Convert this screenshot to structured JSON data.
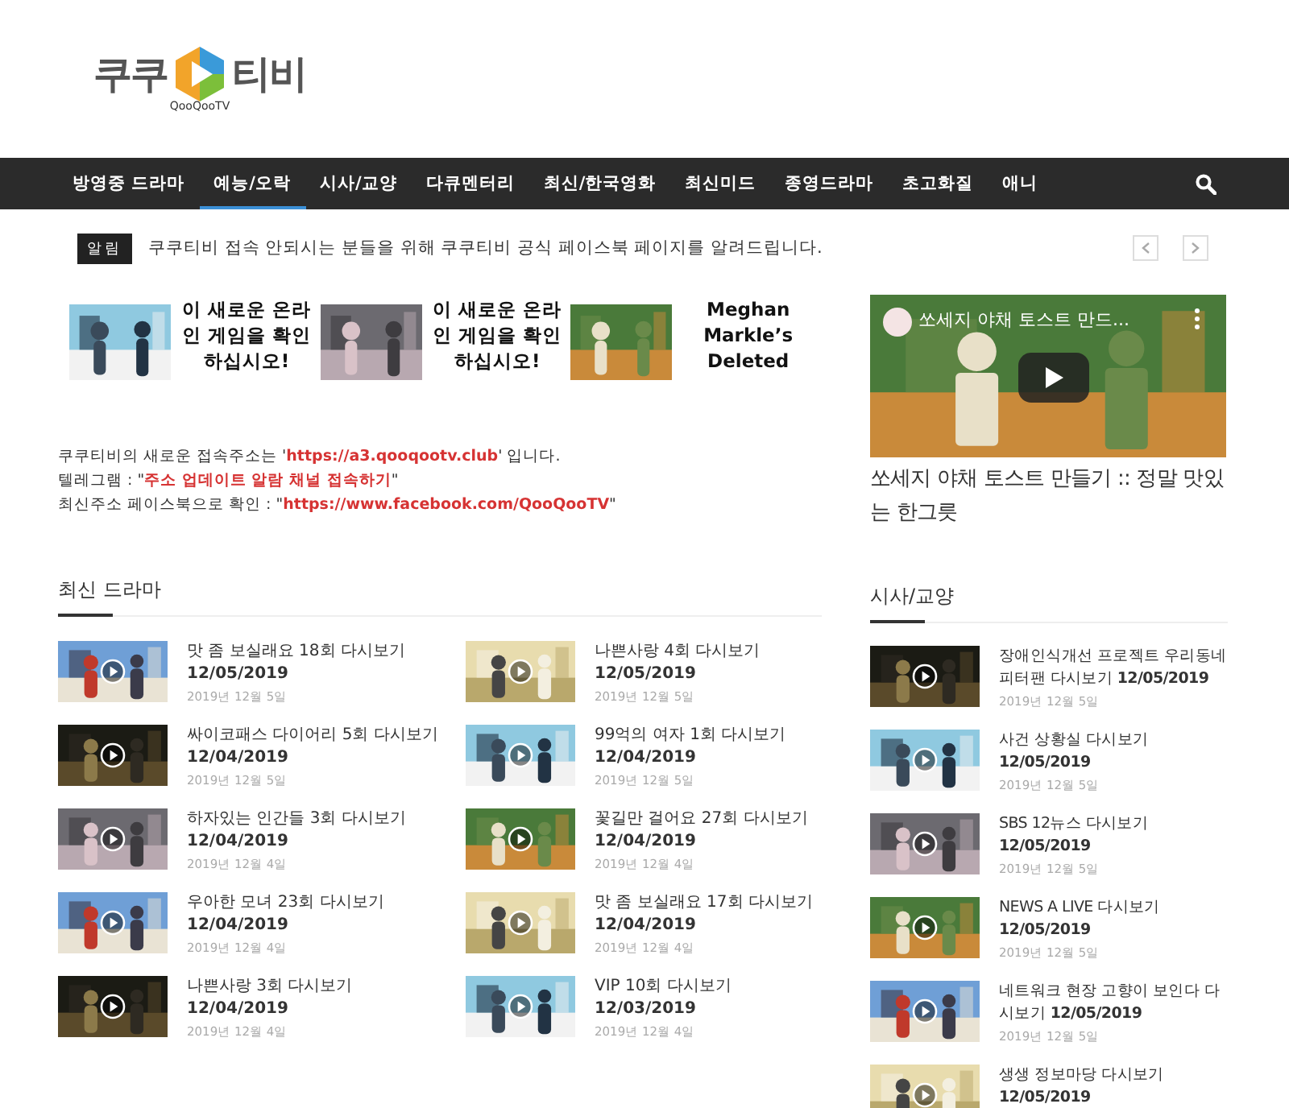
{
  "logo": {
    "left": "쿠쿠",
    "right": "티비",
    "subtitle": "QooQooTV"
  },
  "nav": {
    "items": [
      {
        "label": "방영중 드라마",
        "selected": false
      },
      {
        "label": "예능/오락",
        "selected": true
      },
      {
        "label": "시사/교양",
        "selected": false
      },
      {
        "label": "다큐멘터리",
        "selected": false
      },
      {
        "label": "최신/한국영화",
        "selected": false
      },
      {
        "label": "최신미드",
        "selected": false
      },
      {
        "label": "종영드라마",
        "selected": false
      },
      {
        "label": "초고화질",
        "selected": false
      },
      {
        "label": "애니",
        "selected": false
      }
    ]
  },
  "notice": {
    "badge": "알림",
    "text": "쿠쿠티비 접속 안되시는 분들을 위해 쿠쿠티비 공식 페이스북 페이지를 알려드립니다."
  },
  "ads": [
    {
      "text": "이 새로운 온라인 게임을 확인하십시오!"
    },
    {
      "text": "이 새로운 온라인 게임을 확인하십시오!"
    },
    {
      "text": "Meghan Markle’s Deleted"
    }
  ],
  "info_lines": [
    "쿠쿠티비의 새로운 접속주소는 '**https://a3.qooqootv.club**' 입니다.",
    "텔레그램 : \"**주소 업데이트 알람 채널 접속하기**\"",
    "최신주소 페이스북으로 확인 : \"**https://www.facebook.com/QooQooTV**\""
  ],
  "latest_drama": {
    "heading": "최신 드라마",
    "items": [
      {
        "title": "맛 좀 보실래요 18회 다시보기 **12/05/2019**",
        "meta": "2019년 12월 5일"
      },
      {
        "title": "나쁜사랑 4회 다시보기 **12/05/2019**",
        "meta": "2019년 12월 5일"
      },
      {
        "title": "싸이코패스 다이어리 5회 다시보기 **12/04/2019**",
        "meta": "2019년 12월 5일"
      },
      {
        "title": "99억의 여자 1회 다시보기 **12/04/2019**",
        "meta": "2019년 12월 5일"
      },
      {
        "title": "하자있는 인간들 3회 다시보기 **12/04/2019**",
        "meta": "2019년 12월 4일"
      },
      {
        "title": "꽃길만 걸어요 27회 다시보기 **12/04/2019**",
        "meta": "2019년 12월 4일"
      },
      {
        "title": "우아한 모녀 23회 다시보기 **12/04/2019**",
        "meta": "2019년 12월 4일"
      },
      {
        "title": "맛 좀 보실래요 17회 다시보기 **12/04/2019**",
        "meta": "2019년 12월 4일"
      },
      {
        "title": "나쁜사랑 3회 다시보기 **12/04/2019**",
        "meta": "2019년 12월 4일"
      },
      {
        "title": "VIP 10회 다시보기 **12/03/2019**",
        "meta": "2019년 12월 4일"
      }
    ]
  },
  "video": {
    "overlay_title": "쏘세지 야채 토스트 만드...",
    "caption": "쏘세지 야채 토스트 만들기 :: 정말 맛있는 한그릇"
  },
  "sidebar": {
    "heading": "시사/교양",
    "items": [
      {
        "title": "장애인식개선 프로젝트 우리동네 피터팬 다시보기 **12/05/2019**",
        "meta": "2019년 12월 5일"
      },
      {
        "title": "사건 상황실 다시보기 **12/05/2019**",
        "meta": "2019년 12월 5일"
      },
      {
        "title": "SBS 12뉴스 다시보기 **12/05/2019**",
        "meta": "2019년 12월 5일"
      },
      {
        "title": "NEWS A LIVE 다시보기 **12/05/2019**",
        "meta": "2019년 12월 5일"
      },
      {
        "title": "네트워크 현장 고향이 보인다 다시보기 **12/05/2019**",
        "meta": "2019년 12월 5일"
      },
      {
        "title": "생생 정보마당 다시보기 **12/05/2019**"
      }
    ]
  }
}
